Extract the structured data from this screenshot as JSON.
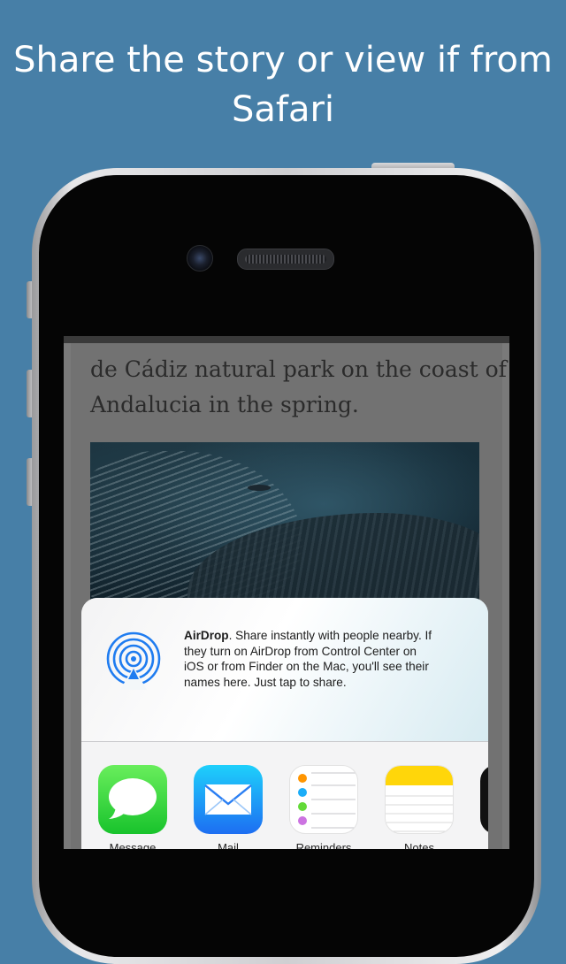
{
  "headline": {
    "line1": "Share the story or view if from",
    "line2": "Safari"
  },
  "article": {
    "lines": [
      "de Cádiz natural park on the coast of",
      "Andalucia in the spring."
    ],
    "image_icon": "whale-photo"
  },
  "share_sheet": {
    "airdrop": {
      "icon": "airdrop-icon",
      "title": "AirDrop",
      "lines": [
        ". Share instantly with people nearby. If",
        "they turn on AirDrop from Control Center on",
        "iOS or from Finder on the Mac, you'll see their",
        "names here. Just tap to share."
      ]
    },
    "apps": [
      {
        "label": "Message",
        "icon": "message-icon"
      },
      {
        "label": "Mail",
        "icon": "mail-icon"
      },
      {
        "label": "Reminders",
        "icon": "reminders-icon"
      },
      {
        "label": "Notes",
        "icon": "notes-icon"
      }
    ]
  },
  "colors": {
    "background": "#477fa7",
    "airdrop_blue": "#1f7cf0",
    "message_green": "#18c32c",
    "mail_blue": "#1d6ef2",
    "notes_yellow": "#ffd60a"
  }
}
